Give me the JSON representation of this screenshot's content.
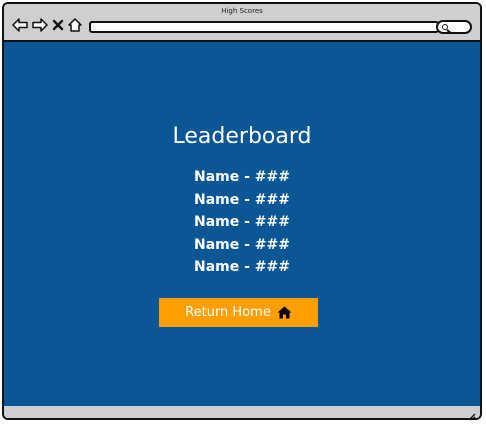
{
  "window": {
    "title": "High Scores"
  },
  "toolbar": {
    "icons": [
      "back-arrow-icon",
      "forward-arrow-icon",
      "close-icon",
      "home-icon"
    ],
    "url_value": "",
    "search_icon": "search-icon"
  },
  "leaderboard": {
    "title": "Leaderboard",
    "scores": [
      "Name - ###",
      "Name - ###",
      "Name - ###",
      "Name - ###",
      "Name - ###"
    ],
    "return_button_label": "Return Home",
    "return_button_icon": "home-icon"
  },
  "colors": {
    "background": "#0b5796",
    "button": "#ff9e00",
    "text": "#ffffff",
    "chrome": "#cfcfcf"
  }
}
